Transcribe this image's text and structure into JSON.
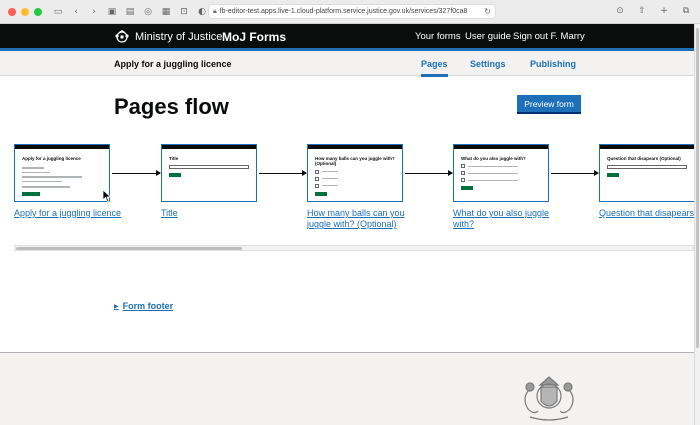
{
  "browser": {
    "url": "fb-editor-test.apps.live-1.cloud-platform.service.justice.gov.uk/services/327f0ca8"
  },
  "header": {
    "org_name": "Ministry of Justice",
    "product_name": "MoJ Forms",
    "nav": {
      "your_forms": "Your forms",
      "user_guide": "User guide",
      "sign_out": "Sign out F. Marry"
    }
  },
  "subnav": {
    "service_name": "Apply for a juggling licence",
    "tabs": [
      "Pages",
      "Settings",
      "Publishing"
    ],
    "active_tab": "Pages"
  },
  "main": {
    "title": "Pages flow",
    "preview_button": "Preview form",
    "flow_items": [
      {
        "link": "Apply for a juggling licence",
        "thumb_title": "Apply for a juggling licence"
      },
      {
        "link": "Title",
        "thumb_title": "Title"
      },
      {
        "link": "How many balls can you juggle with? (Optional)",
        "thumb_title": "How many balls can you juggle with? (Optional)"
      },
      {
        "link": "What do you also juggle with?",
        "thumb_title": "What do you also juggle with?"
      },
      {
        "link": "Question that disapears (Optional)",
        "thumb_title": "Question that disapears (Optional)"
      }
    ],
    "form_footer": "Form footer"
  },
  "colors": {
    "header_bg": "#0b0c0c",
    "accent": "#1d70b8",
    "button_green": "#00703c",
    "subnav_bg": "#f3f2f1"
  }
}
